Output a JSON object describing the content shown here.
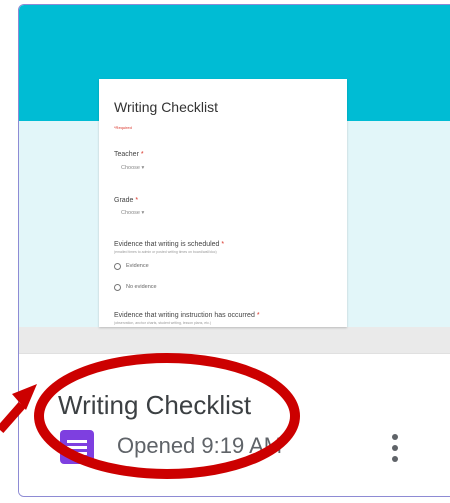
{
  "file_card": {
    "title": "Writing Checklist",
    "opened_label": "Opened 9:19 AM",
    "app_icon": "google-forms-icon",
    "more_icon": "more-vert-icon",
    "colors": {
      "header_band": "#00bcd4",
      "thumb_bg": "#e2f6f9",
      "forms_icon": "#7e3fe0",
      "border": "#8e8bd4",
      "annotation": "#cc0000"
    }
  },
  "form_preview": {
    "title": "Writing Checklist",
    "required_note": "*Required",
    "fields": [
      {
        "label": "Teacher",
        "control": "Choose"
      },
      {
        "label": "Grade",
        "control": "Choose"
      }
    ],
    "question3": {
      "label": "Evidence that writing is scheduled",
      "hint": "(emailed times to admin or posted writing times on board/wall/doc)",
      "options": [
        "Evidence",
        "No evidence"
      ]
    },
    "question4": {
      "label": "Evidence that writing instruction has occurred",
      "hint": "(observation, anchor charts, student writing, lesson plans, etc.)"
    },
    "required_mark": "*"
  },
  "annotations": {
    "shapes": [
      "red-ellipse-highlight",
      "red-arrow"
    ]
  }
}
